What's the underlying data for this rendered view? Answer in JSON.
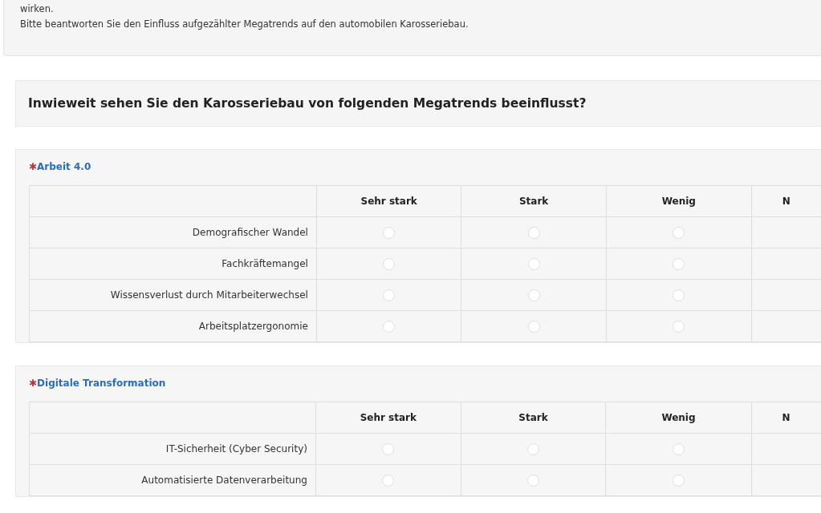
{
  "intro": {
    "lines": [
      "wirken.",
      "Bitte beantworten Sie den Einfluss aufgezählter Megatrends auf den automobilen Karosseriebau."
    ]
  },
  "question": {
    "title": "Inwieweit sehen Sie den Karosseriebau von folgenden Megatrends beeinflusst?"
  },
  "sections": [
    {
      "required_mark": "✱",
      "label": "Arbeit 4.0",
      "columns": [
        "Sehr stark",
        "Stark",
        "Wenig",
        "N"
      ],
      "rows": [
        {
          "label": "Demografischer Wandel",
          "choices": [
            {
              "selected": false
            },
            {
              "selected": false
            },
            {
              "selected": false
            }
          ]
        },
        {
          "label": "Fachkräftemangel",
          "choices": [
            {
              "selected": false
            },
            {
              "selected": false
            },
            {
              "selected": false
            }
          ]
        },
        {
          "label": "Wissensverlust durch Mitarbeiterwechsel",
          "choices": [
            {
              "selected": false
            },
            {
              "selected": false
            },
            {
              "selected": false
            }
          ]
        },
        {
          "label": "Arbeitsplatzergonomie",
          "choices": [
            {
              "selected": false
            },
            {
              "selected": false
            },
            {
              "selected": false
            }
          ]
        }
      ]
    },
    {
      "required_mark": "✱",
      "label": "Digitale Transformation",
      "columns": [
        "Sehr stark",
        "Stark",
        "Wenig",
        "N"
      ],
      "rows": [
        {
          "label": "IT-Sicherheit (Cyber Security)",
          "choices": [
            {
              "selected": false
            },
            {
              "selected": false
            },
            {
              "selected": false
            }
          ]
        },
        {
          "label": "Automatisierte Datenverarbeitung",
          "choices": [
            {
              "selected": false
            },
            {
              "selected": false
            },
            {
              "selected": false
            }
          ]
        }
      ]
    }
  ]
}
